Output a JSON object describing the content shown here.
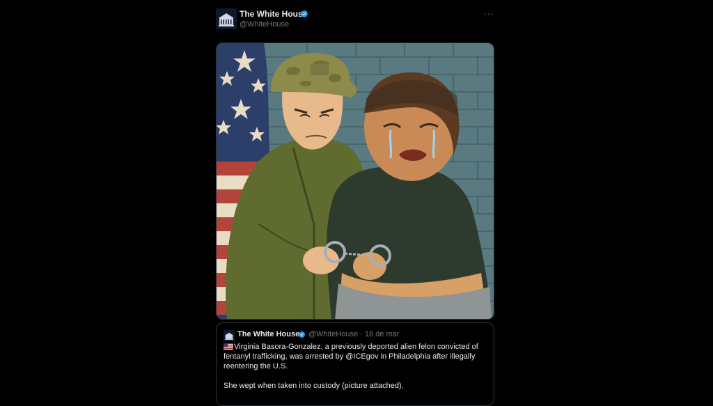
{
  "post": {
    "display_name": "The White House",
    "handle": "@WhiteHouse",
    "more_label": "···",
    "verified_color": "#1d9bf0",
    "media_alt": "Cartoon illustration of a soldier handcuffing a crying woman in front of a brick wall and a U.S. flag"
  },
  "quote": {
    "display_name": "The White House",
    "handle_date": "@WhiteHouse · 18 de mar",
    "flag_icon": "us-flag-emoji",
    "text_line1": "Virginia Basora-Gonzalez, a previously deported alien felon convicted of fentanyl trafficking, was arrested by @ICEgov in Philadelphia after illegally reentering the U.S.",
    "text_line2": "She wept when taken into custody (picture attached)."
  }
}
